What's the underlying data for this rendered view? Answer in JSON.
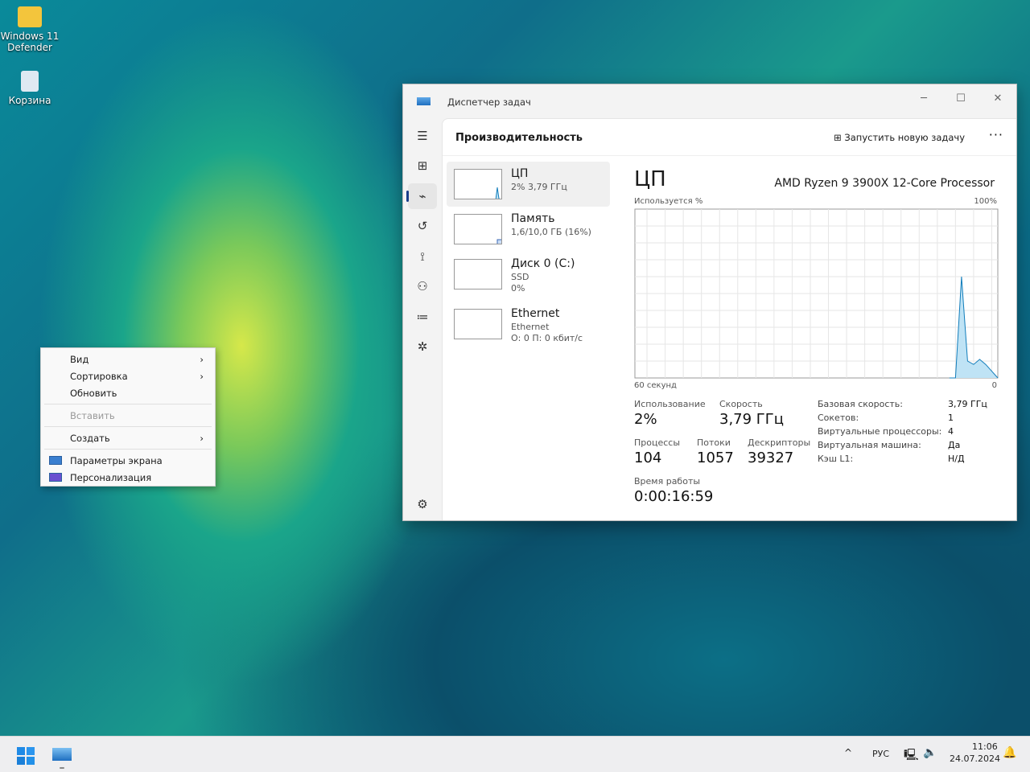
{
  "desktop": {
    "icons": [
      {
        "label": "Windows 11 Defender",
        "icon": "folder-icon"
      },
      {
        "label": "Корзина",
        "icon": "recycle-bin-icon"
      }
    ]
  },
  "context_menu": {
    "items": [
      {
        "label": "Вид",
        "submenu": true
      },
      {
        "label": "Сортировка",
        "submenu": true
      },
      {
        "label": "Обновить"
      },
      {
        "label": "Вставить",
        "disabled": true
      },
      {
        "label": "Создать",
        "submenu": true
      },
      {
        "label": "Параметры экрана",
        "icon": "display-icon"
      },
      {
        "label": "Персонализация",
        "icon": "personalize-icon"
      }
    ]
  },
  "window": {
    "title": "Диспетчер задач",
    "minimize": "─",
    "maximize": "☐",
    "close": "✕"
  },
  "nav": [
    "menu-icon",
    "processes-icon",
    "performance-icon",
    "history-icon",
    "startup-icon",
    "users-icon",
    "details-icon",
    "services-icon",
    "settings-icon"
  ],
  "header": {
    "title": "Производительность",
    "run_task": "Запустить новую задачу",
    "more": "···"
  },
  "resources": [
    {
      "name": "ЦП",
      "sub1": "2% 3,79 ГГц",
      "sub2": ""
    },
    {
      "name": "Память",
      "sub1": "1,6/10,0 ГБ (16%)",
      "sub2": ""
    },
    {
      "name": "Диск 0 (C:)",
      "sub1": "SSD",
      "sub2": "0%"
    },
    {
      "name": "Ethernet",
      "sub1": "Ethernet",
      "sub2": "О: 0 П: 0 кбит/с"
    }
  ],
  "detail": {
    "title": "ЦП",
    "processor": "AMD Ryzen 9 3900X 12-Core Processor",
    "usage_label": "Используется %",
    "max_label": "100%",
    "time_label": "60 секунд",
    "min_label": "0",
    "stats": {
      "usage_l": "Использование",
      "usage": "2%",
      "speed_l": "Скорость",
      "speed": "3,79 ГГц",
      "proc_l": "Процессы",
      "proc": "104",
      "threads_l": "Потоки",
      "threads": "1057",
      "handles_l": "Дескрипторы",
      "handles": "39327",
      "uptime_l": "Время работы",
      "uptime": "0:00:16:59"
    },
    "props": [
      [
        "Базовая скорость:",
        "3,79 ГГц"
      ],
      [
        "Сокетов:",
        "1"
      ],
      [
        "Виртуальные процессоры:",
        "4"
      ],
      [
        "Виртуальная машина:",
        "Да"
      ],
      [
        "Кэш L1:",
        "Н/Д"
      ]
    ]
  },
  "chart_data": {
    "type": "area",
    "xlabel": "60 секунд",
    "ylabel": "Используется %",
    "ylim": [
      0,
      100
    ],
    "xlim": [
      60,
      0
    ],
    "grid": true,
    "x_seconds_ago": [
      8,
      7,
      6,
      5,
      4,
      3,
      2,
      1,
      0
    ],
    "values": [
      0,
      0,
      60,
      10,
      8,
      11,
      8,
      4,
      0
    ],
    "color": "#117dbb"
  },
  "taskbar": {
    "lang": "РУС",
    "time": "11:06",
    "date": "24.07.2024",
    "chevron": "^"
  }
}
